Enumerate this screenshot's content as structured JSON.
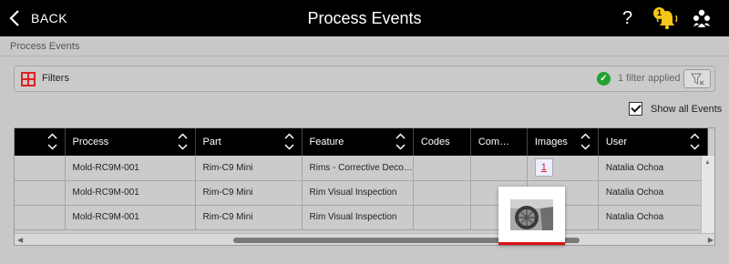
{
  "header": {
    "back_label": "BACK",
    "title": "Process Events",
    "help_label": "?",
    "notification_count": "1"
  },
  "breadcrumb": "Process Events",
  "filters": {
    "label": "Filters",
    "applied_text": "1 filter applied"
  },
  "show_all": {
    "label": "Show all Events",
    "checked": true
  },
  "table": {
    "columns": [
      "",
      "Process",
      "Part",
      "Feature",
      "Codes",
      "Com…",
      "Images",
      "User"
    ],
    "rows": [
      [
        "",
        "Mold-RC9M-001",
        "Rim-C9 Mini",
        "Rims - Corrective Deco…",
        "",
        "",
        "1",
        "Natalia Ochoa"
      ],
      [
        "",
        "Mold-RC9M-001",
        "Rim-C9 Mini",
        "Rim Visual Inspection",
        "",
        "",
        "",
        "Natalia Ochoa"
      ],
      [
        "",
        "Mold-RC9M-001",
        "Rim-C9 Mini",
        "Rim Visual Inspection",
        "",
        "",
        "",
        "Natalia Ochoa"
      ]
    ]
  },
  "colors": {
    "topbar": "#000000",
    "accent_red": "#dd2222",
    "success_green": "#22a233",
    "badge_yellow": "#f5c518"
  },
  "icons": [
    "back-chevron-icon",
    "help-icon",
    "bell-icon",
    "users-icon",
    "filter-plus-icon",
    "check-circle-icon",
    "clear-filter-icon",
    "sort-arrows-icon",
    "checkbox-icon"
  ]
}
